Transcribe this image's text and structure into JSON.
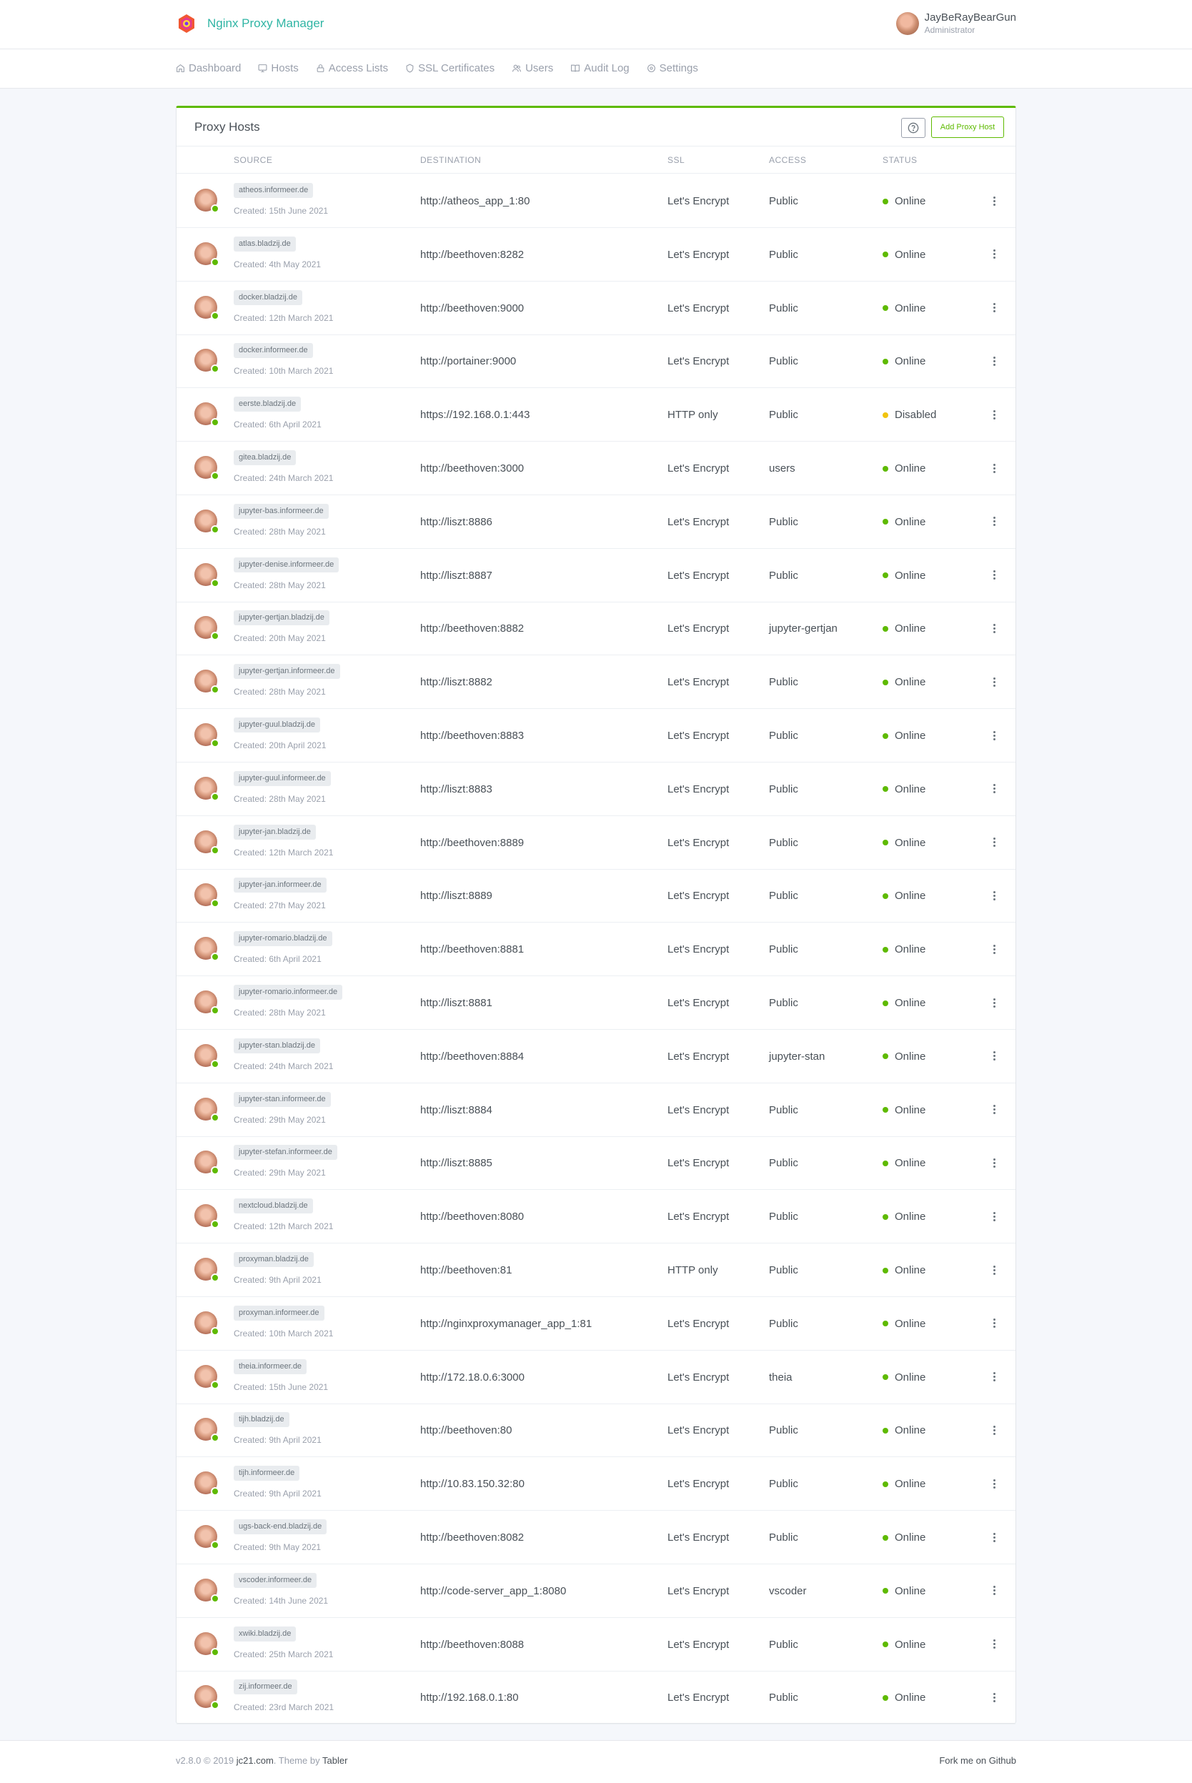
{
  "header": {
    "brand": "Nginx Proxy Manager",
    "user_name": "JayBeRayBearGun",
    "user_role": "Administrator"
  },
  "nav": [
    {
      "label": "Dashboard",
      "icon": "home-icon"
    },
    {
      "label": "Hosts",
      "icon": "monitor-icon"
    },
    {
      "label": "Access Lists",
      "icon": "lock-icon"
    },
    {
      "label": "SSL Certificates",
      "icon": "shield-icon"
    },
    {
      "label": "Users",
      "icon": "users-icon"
    },
    {
      "label": "Audit Log",
      "icon": "book-icon"
    },
    {
      "label": "Settings",
      "icon": "settings-icon"
    }
  ],
  "card": {
    "title": "Proxy Hosts",
    "add_button": "Add Proxy Host",
    "columns": [
      "SOURCE",
      "DESTINATION",
      "SSL",
      "ACCESS",
      "STATUS"
    ]
  },
  "colors": {
    "online": "#5eba00",
    "disabled": "#f1c40f",
    "brand": "#2fb5a4"
  },
  "rows": [
    {
      "source": "atheos.informeer.de",
      "created": "Created: 15th June 2021",
      "destination": "http://atheos_app_1:80",
      "ssl": "Let's Encrypt",
      "access": "Public",
      "status": "Online"
    },
    {
      "source": "atlas.bladzij.de",
      "created": "Created: 4th May 2021",
      "destination": "http://beethoven:8282",
      "ssl": "Let's Encrypt",
      "access": "Public",
      "status": "Online"
    },
    {
      "source": "docker.bladzij.de",
      "created": "Created: 12th March 2021",
      "destination": "http://beethoven:9000",
      "ssl": "Let's Encrypt",
      "access": "Public",
      "status": "Online"
    },
    {
      "source": "docker.informeer.de",
      "created": "Created: 10th March 2021",
      "destination": "http://portainer:9000",
      "ssl": "Let's Encrypt",
      "access": "Public",
      "status": "Online"
    },
    {
      "source": "eerste.bladzij.de",
      "created": "Created: 6th April 2021",
      "destination": "https://192.168.0.1:443",
      "ssl": "HTTP only",
      "access": "Public",
      "status": "Disabled"
    },
    {
      "source": "gitea.bladzij.de",
      "created": "Created: 24th March 2021",
      "destination": "http://beethoven:3000",
      "ssl": "Let's Encrypt",
      "access": "users",
      "status": "Online"
    },
    {
      "source": "jupyter-bas.informeer.de",
      "created": "Created: 28th May 2021",
      "destination": "http://liszt:8886",
      "ssl": "Let's Encrypt",
      "access": "Public",
      "status": "Online"
    },
    {
      "source": "jupyter-denise.informeer.de",
      "created": "Created: 28th May 2021",
      "destination": "http://liszt:8887",
      "ssl": "Let's Encrypt",
      "access": "Public",
      "status": "Online"
    },
    {
      "source": "jupyter-gertjan.bladzij.de",
      "created": "Created: 20th May 2021",
      "destination": "http://beethoven:8882",
      "ssl": "Let's Encrypt",
      "access": "jupyter-gertjan",
      "status": "Online"
    },
    {
      "source": "jupyter-gertjan.informeer.de",
      "created": "Created: 28th May 2021",
      "destination": "http://liszt:8882",
      "ssl": "Let's Encrypt",
      "access": "Public",
      "status": "Online"
    },
    {
      "source": "jupyter-guul.bladzij.de",
      "created": "Created: 20th April 2021",
      "destination": "http://beethoven:8883",
      "ssl": "Let's Encrypt",
      "access": "Public",
      "status": "Online"
    },
    {
      "source": "jupyter-guul.informeer.de",
      "created": "Created: 28th May 2021",
      "destination": "http://liszt:8883",
      "ssl": "Let's Encrypt",
      "access": "Public",
      "status": "Online"
    },
    {
      "source": "jupyter-jan.bladzij.de",
      "created": "Created: 12th March 2021",
      "destination": "http://beethoven:8889",
      "ssl": "Let's Encrypt",
      "access": "Public",
      "status": "Online"
    },
    {
      "source": "jupyter-jan.informeer.de",
      "created": "Created: 27th May 2021",
      "destination": "http://liszt:8889",
      "ssl": "Let's Encrypt",
      "access": "Public",
      "status": "Online"
    },
    {
      "source": "jupyter-romario.bladzij.de",
      "created": "Created: 6th April 2021",
      "destination": "http://beethoven:8881",
      "ssl": "Let's Encrypt",
      "access": "Public",
      "status": "Online"
    },
    {
      "source": "jupyter-romario.informeer.de",
      "created": "Created: 28th May 2021",
      "destination": "http://liszt:8881",
      "ssl": "Let's Encrypt",
      "access": "Public",
      "status": "Online"
    },
    {
      "source": "jupyter-stan.bladzij.de",
      "created": "Created: 24th March 2021",
      "destination": "http://beethoven:8884",
      "ssl": "Let's Encrypt",
      "access": "jupyter-stan",
      "status": "Online"
    },
    {
      "source": "jupyter-stan.informeer.de",
      "created": "Created: 29th May 2021",
      "destination": "http://liszt:8884",
      "ssl": "Let's Encrypt",
      "access": "Public",
      "status": "Online"
    },
    {
      "source": "jupyter-stefan.informeer.de",
      "created": "Created: 29th May 2021",
      "destination": "http://liszt:8885",
      "ssl": "Let's Encrypt",
      "access": "Public",
      "status": "Online"
    },
    {
      "source": "nextcloud.bladzij.de",
      "created": "Created: 12th March 2021",
      "destination": "http://beethoven:8080",
      "ssl": "Let's Encrypt",
      "access": "Public",
      "status": "Online"
    },
    {
      "source": "proxyman.bladzij.de",
      "created": "Created: 9th April 2021",
      "destination": "http://beethoven:81",
      "ssl": "HTTP only",
      "access": "Public",
      "status": "Online"
    },
    {
      "source": "proxyman.informeer.de",
      "created": "Created: 10th March 2021",
      "destination": "http://nginxproxymanager_app_1:81",
      "ssl": "Let's Encrypt",
      "access": "Public",
      "status": "Online"
    },
    {
      "source": "theia.informeer.de",
      "created": "Created: 15th June 2021",
      "destination": "http://172.18.0.6:3000",
      "ssl": "Let's Encrypt",
      "access": "theia",
      "status": "Online"
    },
    {
      "source": "tijh.bladzij.de",
      "created": "Created: 9th April 2021",
      "destination": "http://beethoven:80",
      "ssl": "Let's Encrypt",
      "access": "Public",
      "status": "Online"
    },
    {
      "source": "tijh.informeer.de",
      "created": "Created: 9th April 2021",
      "destination": "http://10.83.150.32:80",
      "ssl": "Let's Encrypt",
      "access": "Public",
      "status": "Online"
    },
    {
      "source": "ugs-back-end.bladzij.de",
      "created": "Created: 9th May 2021",
      "destination": "http://beethoven:8082",
      "ssl": "Let's Encrypt",
      "access": "Public",
      "status": "Online"
    },
    {
      "source": "vscoder.informeer.de",
      "created": "Created: 14th June 2021",
      "destination": "http://code-server_app_1:8080",
      "ssl": "Let's Encrypt",
      "access": "vscoder",
      "status": "Online"
    },
    {
      "source": "xwiki.bladzij.de",
      "created": "Created: 25th March 2021",
      "destination": "http://beethoven:8088",
      "ssl": "Let's Encrypt",
      "access": "Public",
      "status": "Online"
    },
    {
      "source": "zij.informeer.de",
      "created": "Created: 23rd March 2021",
      "destination": "http://192.168.0.1:80",
      "ssl": "Let's Encrypt",
      "access": "Public",
      "status": "Online"
    }
  ],
  "footer": {
    "version": "v2.8.0 © 2019",
    "company": "jc21.com",
    "theme_prefix": ". Theme by",
    "theme": "Tabler",
    "fork": "Fork me on Github"
  }
}
